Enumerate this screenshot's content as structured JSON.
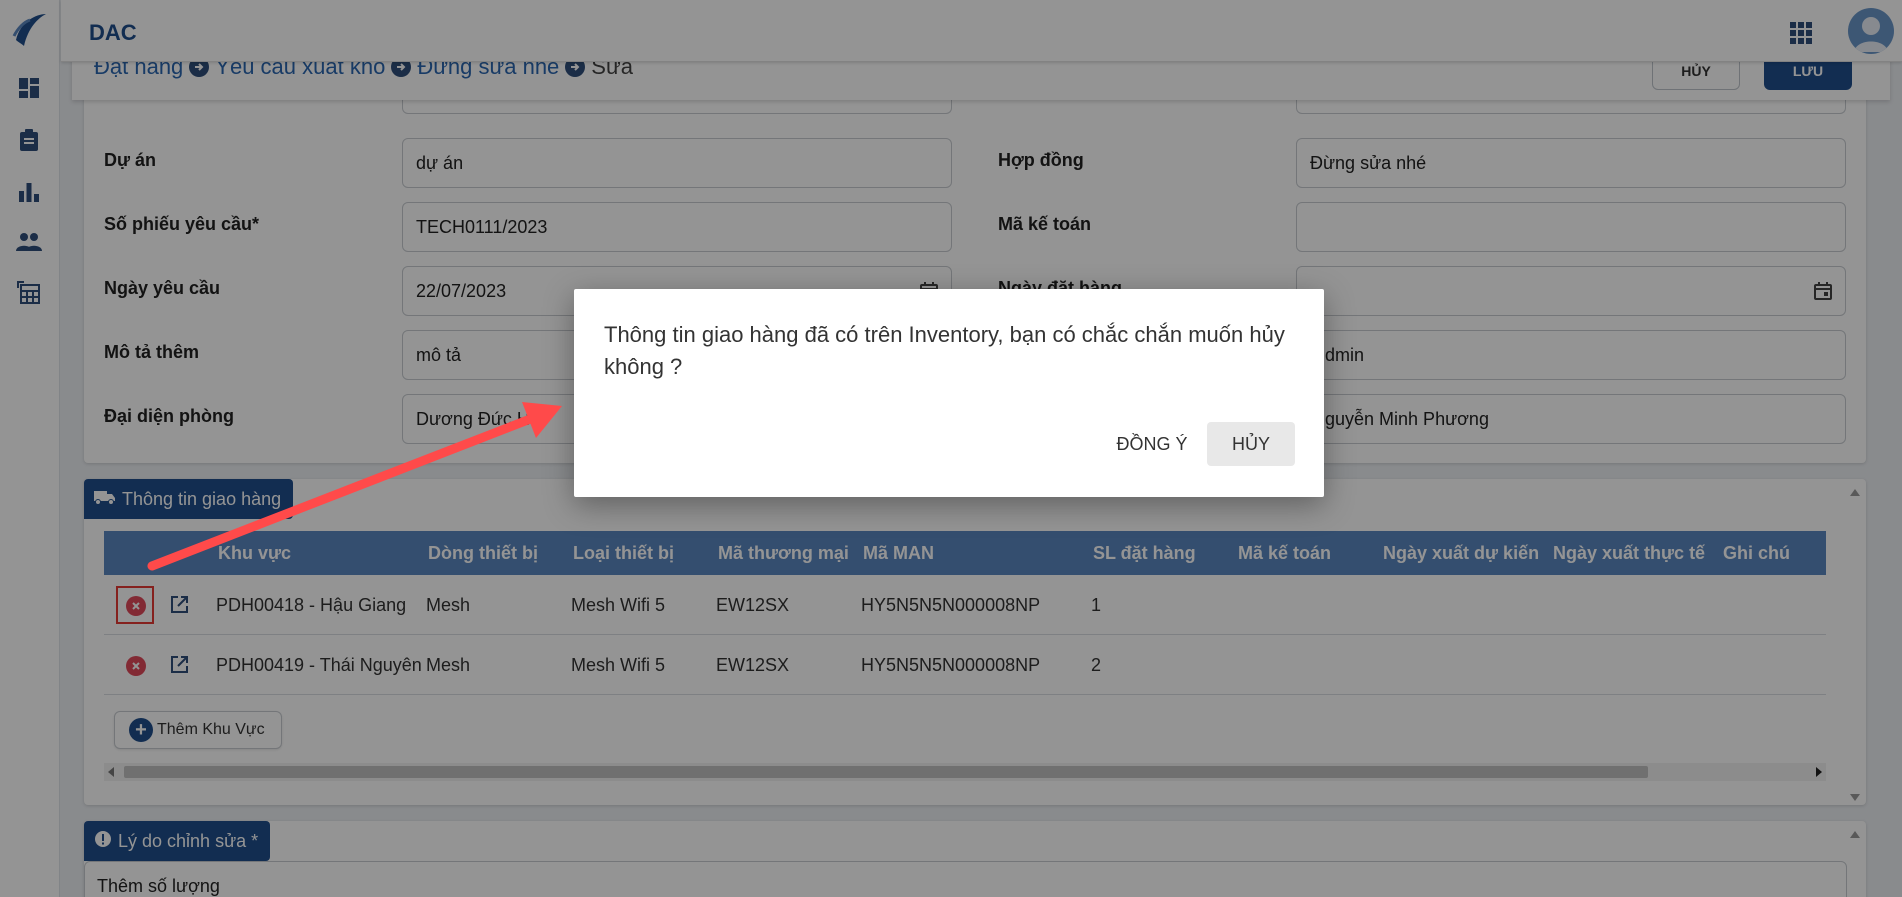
{
  "app": {
    "title": "DAC"
  },
  "sidebar": {
    "items": [
      {
        "icon": "dashboard-icon"
      },
      {
        "icon": "clipboard-icon"
      },
      {
        "icon": "bar-chart-icon"
      },
      {
        "icon": "people-icon"
      },
      {
        "icon": "table-icon"
      }
    ]
  },
  "breadcrumb": [
    "Đặt hàng",
    "Yêu cầu xuất kho",
    "Đừng sửa nhé",
    "Sửa"
  ],
  "toolbar": {
    "cancel_label": "HỦY",
    "save_label": "LƯU"
  },
  "form": {
    "project_label": "Dự án",
    "project_value": "dự án",
    "contract_label": "Hợp đồng",
    "contract_value": "Đừng sửa nhé",
    "request_no_label": "Số phiếu yêu cầu*",
    "request_no_value": "TECH0111/2023",
    "accounting_code_label": "Mã kế toán",
    "accounting_code_value": "",
    "request_date_label": "Ngày yêu cầu",
    "request_date_value": "22/07/2023",
    "order_date_label": "Ngày đặt hàng",
    "order_date_value": "",
    "description_label": "Mô tả thêm",
    "description_value": "mô tả",
    "creator_value": "dmin",
    "dept_rep_label": "Đại diện phòng",
    "dept_rep_value": "Dương Đức Hà",
    "second_rep_value": "guyễn Minh Phương"
  },
  "delivery": {
    "title": "Thông tin giao hàng",
    "columns": [
      "Khu vực",
      "Dòng thiết bị",
      "Loại thiết bị",
      "Mã thương mại",
      "Mã MAN",
      "SL đặt hàng",
      "Mã kế toán",
      "Ngày xuất dự kiến",
      "Ngày xuất thực tế",
      "Ghi chú"
    ],
    "rows": [
      {
        "area": "PDH00418 - Hậu Giang",
        "line": "Mesh",
        "type": "Mesh Wifi 5",
        "trade_code": "EW12SX",
        "man": "HY5N5N5N000008NP",
        "qty": "1"
      },
      {
        "area": "PDH00419 - Thái Nguyên",
        "line": "Mesh",
        "type": "Mesh Wifi 5",
        "trade_code": "EW12SX",
        "man": "HY5N5N5N000008NP",
        "qty": "2"
      }
    ],
    "add_label": "Thêm Khu Vực"
  },
  "reason": {
    "title": "Lý do chỉnh sửa *",
    "value": "Thêm số lượng"
  },
  "dialog": {
    "message": "Thông tin giao hàng đã có trên Inventory, bạn có chắc chắn muốn hủy không ?",
    "agree_label": "ĐỒNG Ý",
    "cancel_label": "HỦY"
  },
  "colors": {
    "primary": "#1f4e8c",
    "table_header": "#5b87bf",
    "danger": "#e0495a",
    "annotation": "#e53935"
  }
}
